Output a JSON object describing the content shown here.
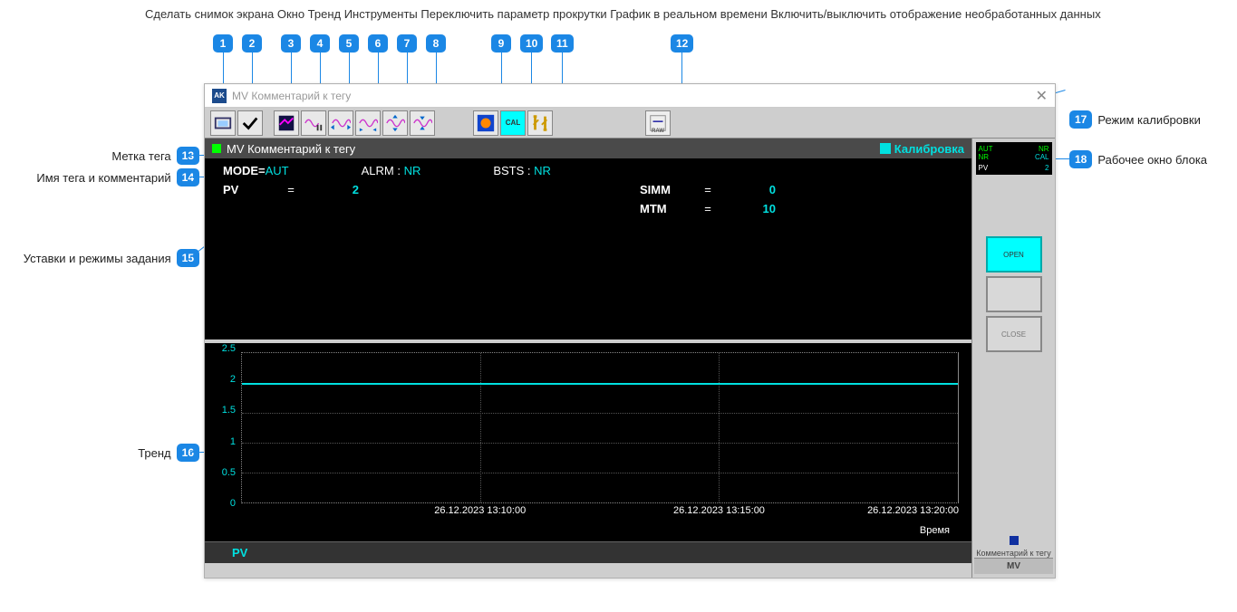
{
  "window": {
    "title": "MV Комментарий к тегу",
    "icon_text": "AK"
  },
  "toolbar": {
    "cal_label": "CAL",
    "raw_label": "RAW"
  },
  "tag_header": {
    "title": "MV Комментарий к тегу",
    "calib": "Калибровка"
  },
  "params": {
    "mode_label": "MODE=",
    "mode_value": "AUT",
    "alrm_label": "ALRM :",
    "alrm_value": "NR",
    "bsts_label": "BSTS :",
    "bsts_value": "NR",
    "left": [
      {
        "name": "PV",
        "value": "2"
      }
    ],
    "right": [
      {
        "name": "SIMM",
        "value": "0"
      },
      {
        "name": "MTM",
        "value": "10"
      }
    ]
  },
  "chart_data": {
    "type": "line",
    "title": "",
    "ylabel": "",
    "xlabel": "Время",
    "ylim": [
      0,
      2.5
    ],
    "yticks": [
      0,
      0.5,
      1,
      1.5,
      2,
      2.5
    ],
    "categories": [
      "26.12.2023 13:10:00",
      "26.12.2023 13:15:00",
      "26.12.2023 13:20:00"
    ],
    "series": [
      {
        "name": "PV",
        "color": "#00e0e0",
        "values": [
          2,
          2,
          2
        ]
      }
    ]
  },
  "legend": {
    "pv": "PV"
  },
  "side": {
    "mini": {
      "r1a": "AUT",
      "r1b": "NR",
      "r2a": "NR",
      "r2b": "CAL",
      "pv_label": "PV",
      "pv_value": "2"
    },
    "open": "OPEN",
    "close": "CLOSE",
    "comment": "Комментарий к тегу",
    "mv": "MV"
  },
  "annotations": {
    "top_overlap": "Сделать снимок экрана Окно Тренд Инструменты Переключить параметр прокрутки График в реальном времени Включить/выключить отображение необработанных данных",
    "left": {
      "13": "Метка тега",
      "14": "Имя тега и комментарий",
      "15": "Уставки и режимы задания",
      "16": "Тренд"
    },
    "right": {
      "17": "Режим калибровки",
      "18": "Рабочее окно блока"
    }
  }
}
